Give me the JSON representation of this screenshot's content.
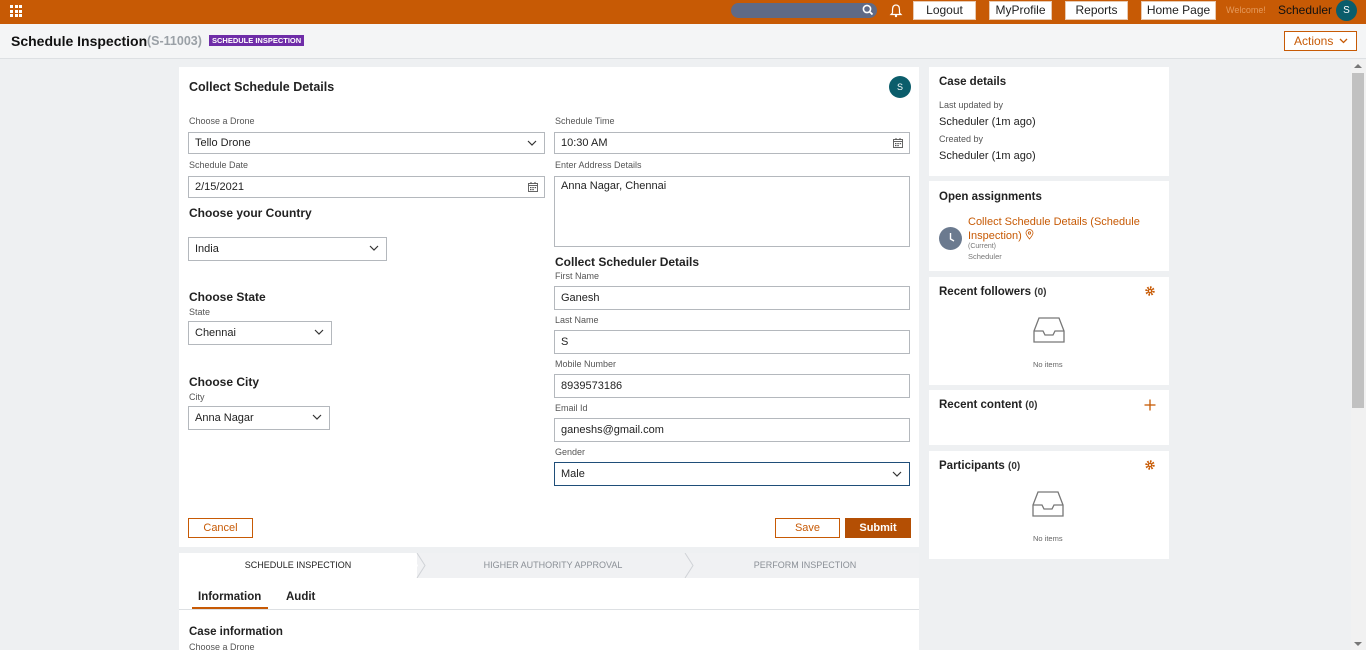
{
  "topbar": {
    "logout": "Logout",
    "myprofile": "MyProfile",
    "reports": "Reports",
    "home": "Home Page",
    "welcome": "Welcome!",
    "user": "Scheduler",
    "avatar": "S",
    "accent": "#c75a05"
  },
  "header": {
    "title": "Schedule Inspection",
    "case_id": "(S-11003)",
    "badge": "SCHEDULE INSPECTION",
    "actions": "Actions"
  },
  "form": {
    "title": "Collect Schedule Details",
    "avatar": "S",
    "drone_label": "Choose a Drone",
    "drone_value": "Tello Drone",
    "date_label": "Schedule Date",
    "date_value": "2/15/2021",
    "country_section": "Choose your Country",
    "country_value": "India",
    "state_section": "Choose State",
    "state_label": "State",
    "state_value": "Chennai",
    "city_section": "Choose City",
    "city_label": "City",
    "city_value": "Anna Nagar",
    "time_label": "Schedule Time",
    "time_value": "10:30 AM",
    "address_label": "Enter Address Details",
    "address_value": "Anna Nagar, Chennai",
    "scheduler_section": "Collect Scheduler Details",
    "first_label": "First Name",
    "first_value": "Ganesh",
    "last_label": "Last Name",
    "last_value": "S",
    "mobile_label": "Mobile Number",
    "mobile_value": "8939573186",
    "email_label": "Email Id",
    "email_value": "ganeshs@gmail.com",
    "gender_label": "Gender",
    "gender_value": "Male",
    "cancel": "Cancel",
    "save": "Save",
    "submit": "Submit"
  },
  "stages": [
    "SCHEDULE INSPECTION",
    "HIGHER AUTHORITY APPROVAL",
    "PERFORM INSPECTION"
  ],
  "tabs": [
    "Information",
    "Audit"
  ],
  "case_info": {
    "title": "Case information",
    "first_label": "Choose a Drone"
  },
  "sidebar": {
    "case_details": {
      "title": "Case details",
      "updated_label": "Last updated by",
      "updated_value": "Scheduler (1m ago)",
      "created_label": "Created by",
      "created_value": "Scheduler (1m ago)"
    },
    "assignments": {
      "title": "Open assignments",
      "link": "Collect Schedule Details (Schedule Inspection)",
      "current": "(Current)",
      "assignee": "Scheduler"
    },
    "followers": {
      "title": "Recent followers",
      "count": "(0)",
      "empty": "No items"
    },
    "content": {
      "title": "Recent content",
      "count": "(0)"
    },
    "participants": {
      "title": "Participants",
      "count": "(0)",
      "empty": "No items"
    }
  }
}
